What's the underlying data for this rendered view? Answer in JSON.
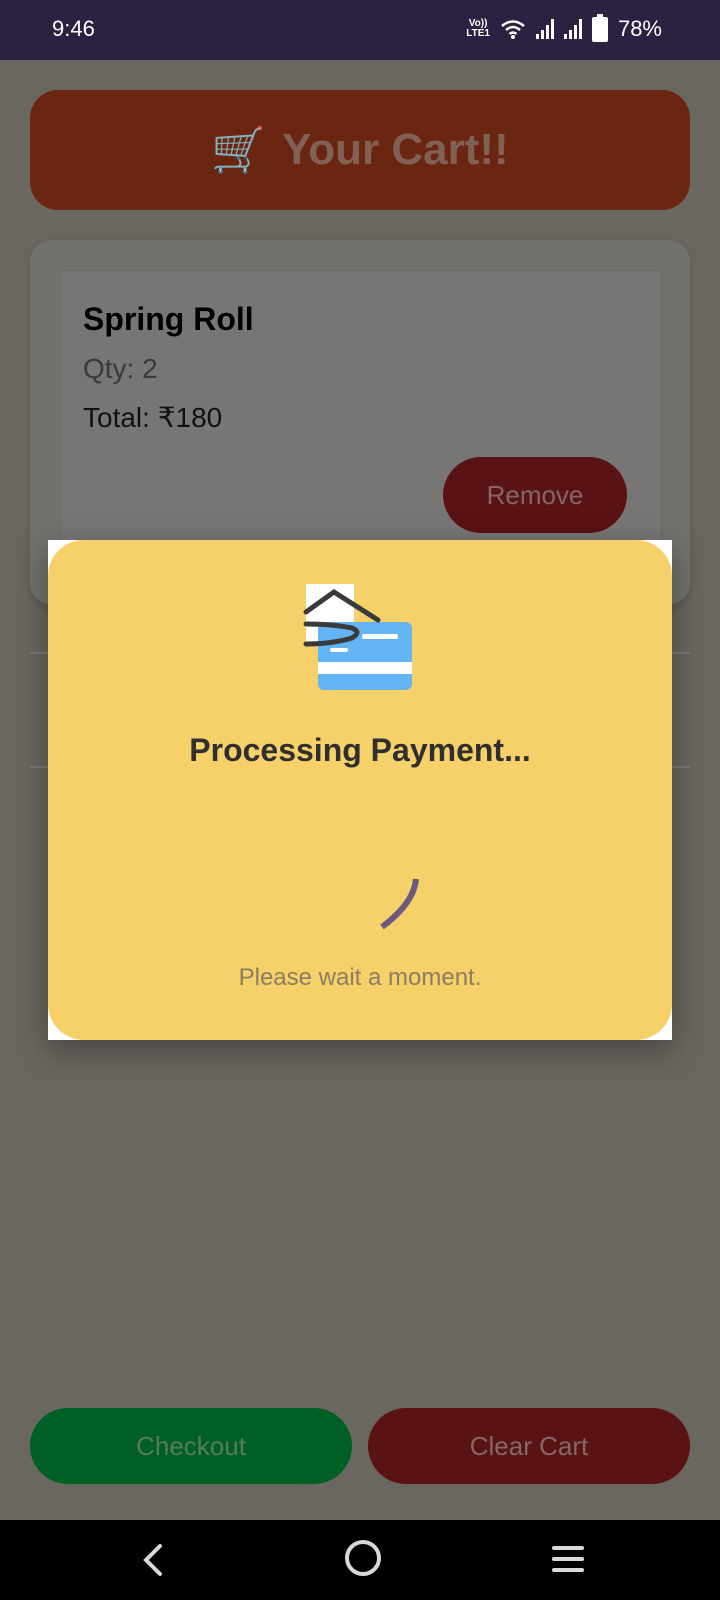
{
  "status_bar": {
    "time": "9:46",
    "network_badge_top": "Vo))",
    "network_badge_bottom": "LTE1",
    "battery_percent": "78%"
  },
  "header": {
    "icon": "🛒",
    "title": "Your Cart!!"
  },
  "cart_items": [
    {
      "name": "Spring Roll",
      "qty_text": "Qty: 2",
      "total_text": "Total: ₹180",
      "remove_label": "Remove"
    }
  ],
  "actions": {
    "checkout_label": "Checkout",
    "clear_cart_label": "Clear Cart"
  },
  "modal": {
    "title": "Processing Payment...",
    "subtitle": "Please wait a moment.",
    "icon": "card-payment-icon"
  },
  "colors": {
    "status_bar": "#2b2141",
    "header_banner": "#6b2611",
    "modal_bg": "#f6d068",
    "checkout": "#005f25",
    "clear_cart": "#5a1313"
  }
}
